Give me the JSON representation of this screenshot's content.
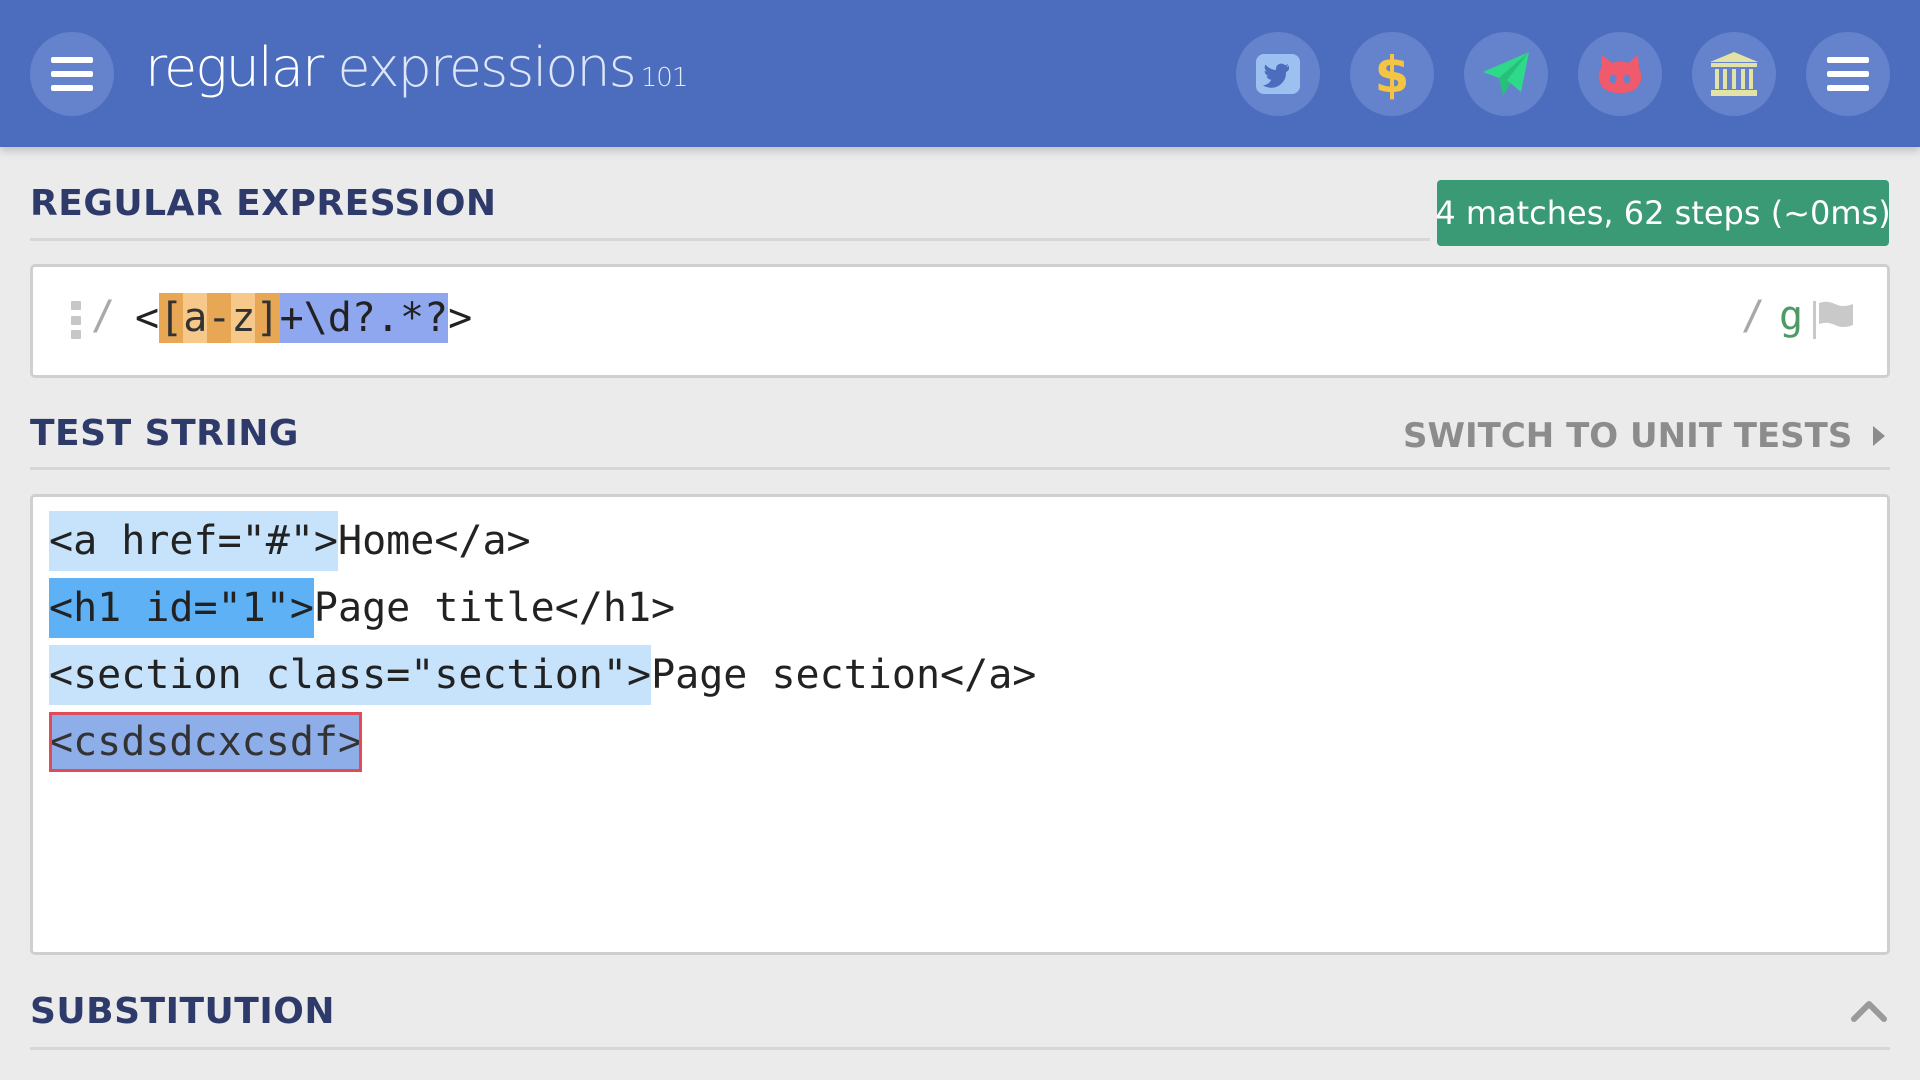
{
  "header": {
    "logo_word1": "regular",
    "logo_word2": " expressions",
    "logo_version": "101",
    "colors": {
      "bar": "#4c6cbd",
      "button": "#6583cc"
    },
    "icons": [
      "menu-icon",
      "twitter-icon",
      "dollar-icon",
      "send-icon",
      "github-icon",
      "library-icon",
      "menu-icon"
    ]
  },
  "regex_section": {
    "title": "REGULAR EXPRESSION",
    "match_info": "4 matches, 62 steps (~0ms)",
    "open_delimiter": "/",
    "close_delimiter": "/",
    "flags": "g",
    "tokens": [
      {
        "text": "<",
        "kind": "plain"
      },
      {
        "text": "[",
        "kind": "cls-bracket"
      },
      {
        "text": "a",
        "kind": "cls-char"
      },
      {
        "text": "-",
        "kind": "cls-range"
      },
      {
        "text": "z",
        "kind": "cls-char"
      },
      {
        "text": "]",
        "kind": "cls-bracket"
      },
      {
        "text": "+\\d?.*?",
        "kind": "quant"
      },
      {
        "text": ">",
        "kind": "plain"
      }
    ]
  },
  "test_section": {
    "title": "TEST STRING",
    "switch_label": "SWITCH TO UNIT TESTS",
    "lines": [
      {
        "match": "<a href=\"#\">",
        "rest": "Home</a>",
        "style": "light"
      },
      {
        "match": "<h1 id=\"1\">",
        "rest": "Page title</h1>",
        "style": "mid"
      },
      {
        "match": "<section class=\"section\">",
        "rest": "Page section</a>",
        "style": "light"
      },
      {
        "match": "<csdsdcxcsdf>",
        "rest": "",
        "style": "sel"
      }
    ]
  },
  "substitution_section": {
    "title": "SUBSTITUTION"
  }
}
